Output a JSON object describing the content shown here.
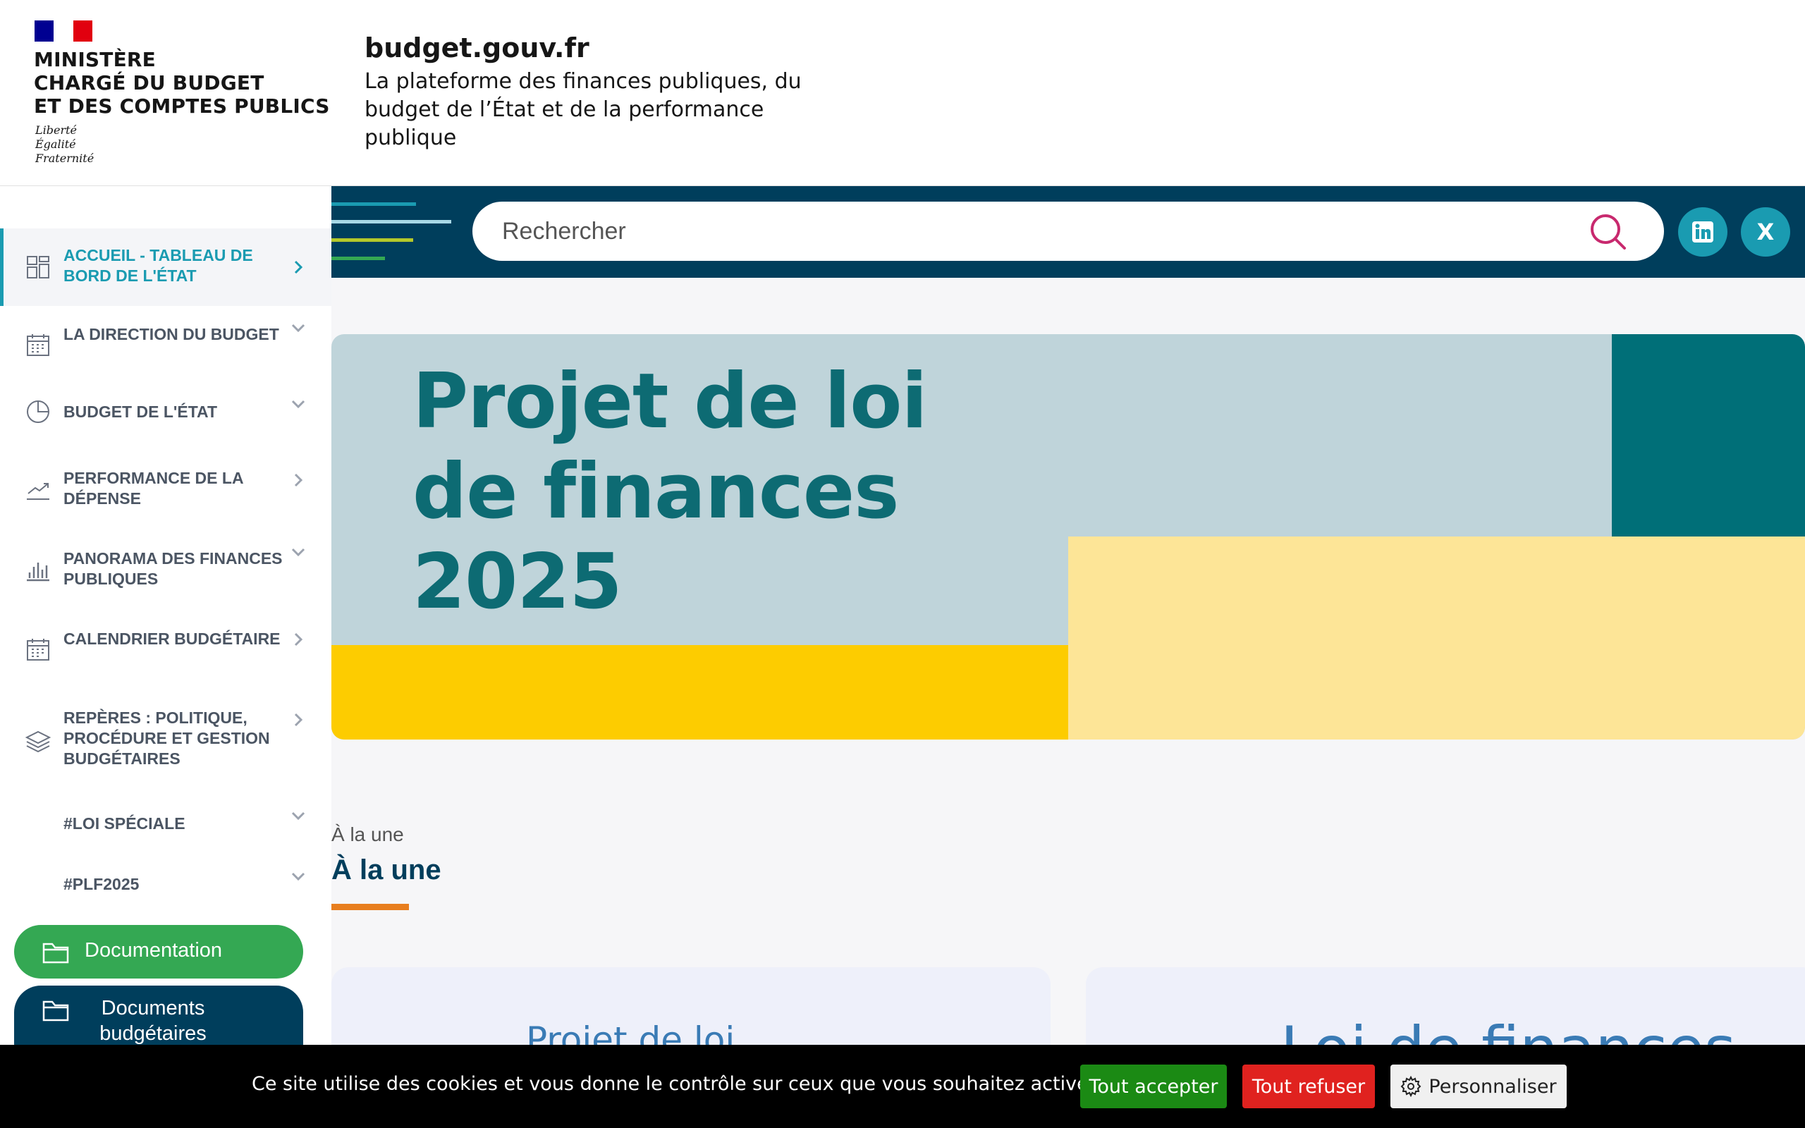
{
  "header": {
    "ministry_lines": [
      "MINISTÈRE",
      "CHARGÉ DU BUDGET",
      "ET DES COMPTES PUBLICS"
    ],
    "motto_lines": [
      "Liberté",
      "Égalité",
      "Fraternité"
    ],
    "site_name": "budget.gouv.fr",
    "tagline": "La plateforme des finances publiques, du budget de l’État et de la performance publique"
  },
  "sidebar": {
    "items": [
      {
        "label": "ACCUEIL - TABLEAU DE BORD DE L'ÉTAT",
        "icon": "dashboard-icon",
        "chevron": "right",
        "active": true
      },
      {
        "label": "LA DIRECTION DU BUDGET",
        "icon": "calendar-icon",
        "chevron": "down"
      },
      {
        "label": "BUDGET DE L'ÉTAT",
        "icon": "pie-chart-icon",
        "chevron": "down"
      },
      {
        "label": "PERFORMANCE DE LA DÉPENSE",
        "icon": "trend-icon",
        "chevron": "right"
      },
      {
        "label": "PANORAMA DES FINANCES PUBLIQUES",
        "icon": "bar-chart-icon",
        "chevron": "down"
      },
      {
        "label": "CALENDRIER BUDGÉTAIRE",
        "icon": "calendar-icon",
        "chevron": "right"
      },
      {
        "label": "REPÈRES : POLITIQUE, PROCÉDURE ET GESTION BUDGÉTAIRES",
        "icon": "layers-icon",
        "chevron": "right"
      },
      {
        "label": "#LOI SPÉCIALE",
        "icon": "",
        "chevron": "down"
      },
      {
        "label": "#PLF2025",
        "icon": "",
        "chevron": "down"
      }
    ],
    "documentation_label": "Documentation",
    "documents_label": "Documents budgétaires"
  },
  "search": {
    "placeholder": "Rechercher"
  },
  "banner": {
    "title_lines": [
      "Projet de loi",
      "de finances",
      "2025"
    ]
  },
  "une": {
    "kicker": "À la une",
    "title": "À la une"
  },
  "cards": [
    {
      "title": "Projet de loi"
    },
    {
      "title": "Loi de finances"
    }
  ],
  "cookie": {
    "text": "Ce site utilise des cookies et vous donne le contrôle sur ceux que vous souhaitez activer",
    "accept": "Tout accepter",
    "refuse": "Tout refuser",
    "customize": "Personnaliser"
  },
  "colors": {
    "navy": "#003e5c",
    "teal": "#1a9bb1",
    "green": "#34a853",
    "orange": "#e87e1e",
    "accept": "#1b8a14",
    "refuse": "#e0221f"
  }
}
